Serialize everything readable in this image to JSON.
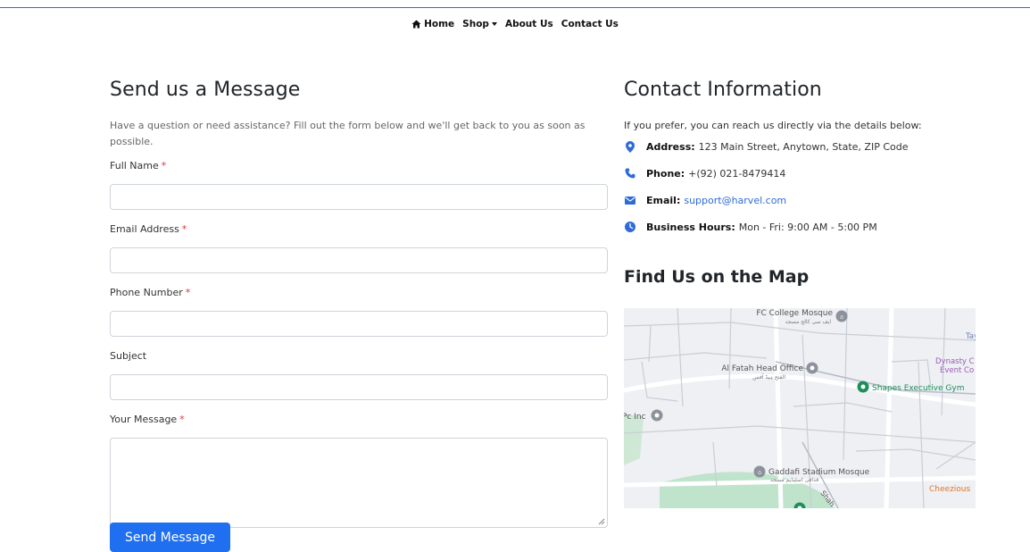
{
  "nav": {
    "items": [
      {
        "label": "Home",
        "icon": "home-icon"
      },
      {
        "label": "Shop",
        "icon": "caret-down-icon"
      },
      {
        "label": "About Us"
      },
      {
        "label": "Contact Us"
      }
    ]
  },
  "form": {
    "title": "Send us a Message",
    "intro": "Have a question or need assistance? Fill out the form below and we'll get back to you as soon as possible.",
    "required_mark": "*",
    "fields": [
      {
        "label": "Full Name",
        "required": true,
        "value": ""
      },
      {
        "label": "Email Address",
        "required": true,
        "value": ""
      },
      {
        "label": "Phone Number",
        "required": true,
        "value": ""
      },
      {
        "label": "Subject",
        "required": false,
        "value": ""
      },
      {
        "label": "Your Message",
        "required": true,
        "value": ""
      }
    ],
    "submit_label": "Send Message"
  },
  "contact": {
    "title": "Contact Information",
    "intro": "If you prefer, you can reach us directly via the details below:",
    "items": [
      {
        "icon": "map-pin-icon",
        "label": "Address:",
        "value": "123 Main Street, Anytown, State, ZIP Code"
      },
      {
        "icon": "phone-icon",
        "label": "Phone:",
        "value": "+(92) 021-8479414"
      },
      {
        "icon": "envelope-icon",
        "label": "Email:",
        "value": "support@harvel.com"
      },
      {
        "icon": "clock-icon",
        "label": "Business Hours:",
        "value": "Mon - Fri: 9:00 AM - 5:00 PM"
      }
    ]
  },
  "map": {
    "title": "Find Us on the Map",
    "places": [
      {
        "name": "FC College Mosque",
        "name_local": "ایف سی کالج مسجد"
      },
      {
        "name": "Al Fatah Head Office",
        "name_local": "الفتح ہیڈ آفس"
      },
      {
        "name": "Shapes Executive Gym"
      },
      {
        "name": "Dynasty C"
      },
      {
        "name": "Event Co"
      },
      {
        "name": "Gaddafi Stadium Mosque",
        "name_local": "قذافی اسٹیڈیم مسجد"
      },
      {
        "name": "Cheezious"
      },
      {
        "name": "Pc Inc"
      },
      {
        "name": "Tay"
      },
      {
        "name": "Shah"
      }
    ]
  },
  "colors": {
    "accent": "#1f6ff0",
    "link": "#2f6bd8",
    "required": "#dc3545"
  }
}
